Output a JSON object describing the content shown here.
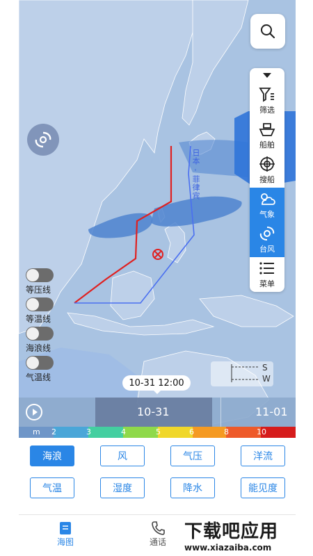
{
  "map": {
    "route_label": "日本 - 菲律宾",
    "colors": {
      "sea": "#a9c3e2",
      "land": "#b9cde7",
      "route_red": "#e02020",
      "route_blue": "#4a6ff0"
    }
  },
  "toolbar": {
    "items": [
      {
        "icon": "filter-icon",
        "label": "筛选"
      },
      {
        "icon": "ship-icon",
        "label": "船舶"
      },
      {
        "icon": "target-icon",
        "label": "搜船"
      },
      {
        "icon": "weather-icon",
        "label": "气象"
      },
      {
        "icon": "typhoon-icon",
        "label": "台风"
      },
      {
        "icon": "menu-icon",
        "label": "菜单"
      }
    ]
  },
  "toggles": [
    {
      "label": "等压线",
      "on": false
    },
    {
      "label": "等温线",
      "on": false
    },
    {
      "label": "海浪线",
      "on": false
    },
    {
      "label": "气温线",
      "on": false
    }
  ],
  "scale": {
    "s_label": "S",
    "w_label": "W"
  },
  "timeline": {
    "bubble": "10-31 12:00",
    "current": "10-31",
    "next": "11-01"
  },
  "legend": {
    "unit": "m",
    "values": [
      "2",
      "3",
      "4",
      "5",
      "6",
      "8",
      "10"
    ]
  },
  "layers": {
    "row1": [
      "海浪",
      "风",
      "气压",
      "洋流"
    ],
    "row2": [
      "气温",
      "湿度",
      "降水",
      "能见度"
    ],
    "active": "海浪"
  },
  "nav": {
    "items": [
      {
        "icon": "map-icon",
        "label": "海图",
        "active": true
      },
      {
        "icon": "phone-icon",
        "label": "通话",
        "active": false
      }
    ]
  },
  "watermark": {
    "text": "下载吧应用",
    "url": "www.xiazaiba.com"
  }
}
